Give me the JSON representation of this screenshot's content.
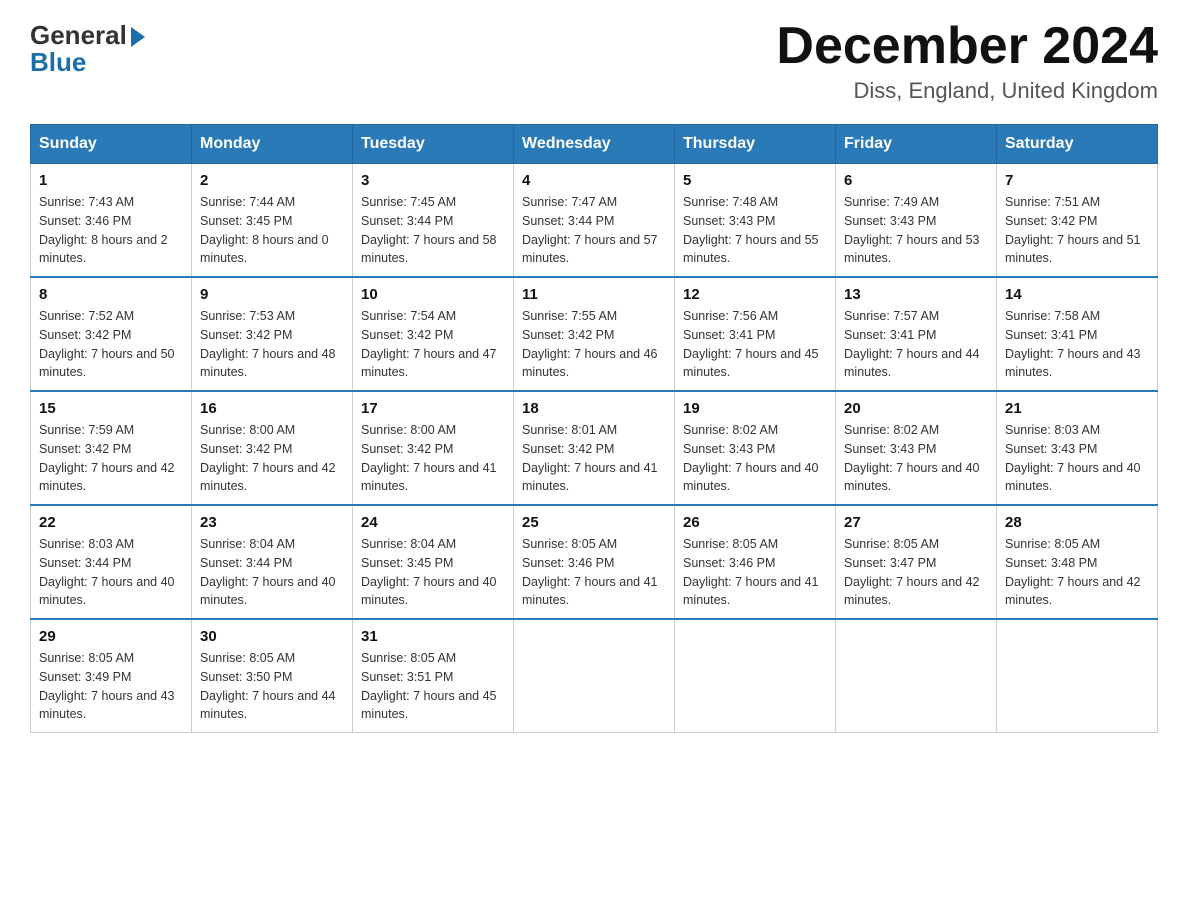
{
  "header": {
    "logo_general": "General",
    "logo_blue": "Blue",
    "month_title": "December 2024",
    "location": "Diss, England, United Kingdom"
  },
  "days_of_week": [
    "Sunday",
    "Monday",
    "Tuesday",
    "Wednesday",
    "Thursday",
    "Friday",
    "Saturday"
  ],
  "weeks": [
    [
      {
        "day": "1",
        "sunrise": "7:43 AM",
        "sunset": "3:46 PM",
        "daylight": "8 hours and 2 minutes."
      },
      {
        "day": "2",
        "sunrise": "7:44 AM",
        "sunset": "3:45 PM",
        "daylight": "8 hours and 0 minutes."
      },
      {
        "day": "3",
        "sunrise": "7:45 AM",
        "sunset": "3:44 PM",
        "daylight": "7 hours and 58 minutes."
      },
      {
        "day": "4",
        "sunrise": "7:47 AM",
        "sunset": "3:44 PM",
        "daylight": "7 hours and 57 minutes."
      },
      {
        "day": "5",
        "sunrise": "7:48 AM",
        "sunset": "3:43 PM",
        "daylight": "7 hours and 55 minutes."
      },
      {
        "day": "6",
        "sunrise": "7:49 AM",
        "sunset": "3:43 PM",
        "daylight": "7 hours and 53 minutes."
      },
      {
        "day": "7",
        "sunrise": "7:51 AM",
        "sunset": "3:42 PM",
        "daylight": "7 hours and 51 minutes."
      }
    ],
    [
      {
        "day": "8",
        "sunrise": "7:52 AM",
        "sunset": "3:42 PM",
        "daylight": "7 hours and 50 minutes."
      },
      {
        "day": "9",
        "sunrise": "7:53 AM",
        "sunset": "3:42 PM",
        "daylight": "7 hours and 48 minutes."
      },
      {
        "day": "10",
        "sunrise": "7:54 AM",
        "sunset": "3:42 PM",
        "daylight": "7 hours and 47 minutes."
      },
      {
        "day": "11",
        "sunrise": "7:55 AM",
        "sunset": "3:42 PM",
        "daylight": "7 hours and 46 minutes."
      },
      {
        "day": "12",
        "sunrise": "7:56 AM",
        "sunset": "3:41 PM",
        "daylight": "7 hours and 45 minutes."
      },
      {
        "day": "13",
        "sunrise": "7:57 AM",
        "sunset": "3:41 PM",
        "daylight": "7 hours and 44 minutes."
      },
      {
        "day": "14",
        "sunrise": "7:58 AM",
        "sunset": "3:41 PM",
        "daylight": "7 hours and 43 minutes."
      }
    ],
    [
      {
        "day": "15",
        "sunrise": "7:59 AM",
        "sunset": "3:42 PM",
        "daylight": "7 hours and 42 minutes."
      },
      {
        "day": "16",
        "sunrise": "8:00 AM",
        "sunset": "3:42 PM",
        "daylight": "7 hours and 42 minutes."
      },
      {
        "day": "17",
        "sunrise": "8:00 AM",
        "sunset": "3:42 PM",
        "daylight": "7 hours and 41 minutes."
      },
      {
        "day": "18",
        "sunrise": "8:01 AM",
        "sunset": "3:42 PM",
        "daylight": "7 hours and 41 minutes."
      },
      {
        "day": "19",
        "sunrise": "8:02 AM",
        "sunset": "3:43 PM",
        "daylight": "7 hours and 40 minutes."
      },
      {
        "day": "20",
        "sunrise": "8:02 AM",
        "sunset": "3:43 PM",
        "daylight": "7 hours and 40 minutes."
      },
      {
        "day": "21",
        "sunrise": "8:03 AM",
        "sunset": "3:43 PM",
        "daylight": "7 hours and 40 minutes."
      }
    ],
    [
      {
        "day": "22",
        "sunrise": "8:03 AM",
        "sunset": "3:44 PM",
        "daylight": "7 hours and 40 minutes."
      },
      {
        "day": "23",
        "sunrise": "8:04 AM",
        "sunset": "3:44 PM",
        "daylight": "7 hours and 40 minutes."
      },
      {
        "day": "24",
        "sunrise": "8:04 AM",
        "sunset": "3:45 PM",
        "daylight": "7 hours and 40 minutes."
      },
      {
        "day": "25",
        "sunrise": "8:05 AM",
        "sunset": "3:46 PM",
        "daylight": "7 hours and 41 minutes."
      },
      {
        "day": "26",
        "sunrise": "8:05 AM",
        "sunset": "3:46 PM",
        "daylight": "7 hours and 41 minutes."
      },
      {
        "day": "27",
        "sunrise": "8:05 AM",
        "sunset": "3:47 PM",
        "daylight": "7 hours and 42 minutes."
      },
      {
        "day": "28",
        "sunrise": "8:05 AM",
        "sunset": "3:48 PM",
        "daylight": "7 hours and 42 minutes."
      }
    ],
    [
      {
        "day": "29",
        "sunrise": "8:05 AM",
        "sunset": "3:49 PM",
        "daylight": "7 hours and 43 minutes."
      },
      {
        "day": "30",
        "sunrise": "8:05 AM",
        "sunset": "3:50 PM",
        "daylight": "7 hours and 44 minutes."
      },
      {
        "day": "31",
        "sunrise": "8:05 AM",
        "sunset": "3:51 PM",
        "daylight": "7 hours and 45 minutes."
      },
      null,
      null,
      null,
      null
    ]
  ]
}
